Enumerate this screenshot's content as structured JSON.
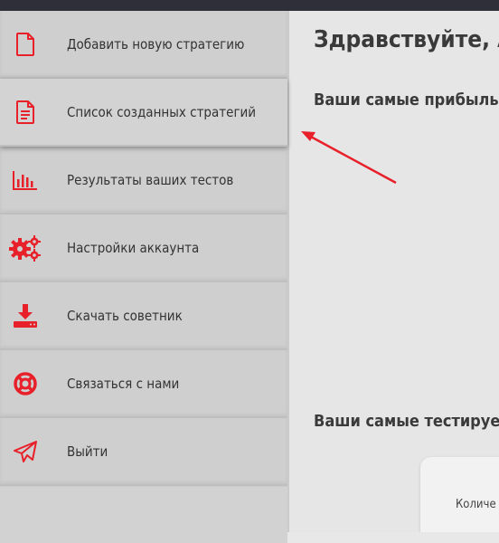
{
  "colors": {
    "accent": "#e8202a",
    "topbar": "#2e2f38",
    "sidebar_bg": "#cbcbcb",
    "main_bg": "#e6e6e6"
  },
  "sidebar": {
    "items": [
      {
        "label": "Добавить новую стратегию",
        "icon": "file-icon"
      },
      {
        "label": "Список созданных стратегий",
        "icon": "document-list-icon"
      },
      {
        "label": "Результаты ваших тестов",
        "icon": "bar-chart-icon"
      },
      {
        "label": "Настройки аккаунта",
        "icon": "gears-icon"
      },
      {
        "label": "Скачать советник",
        "icon": "download-icon"
      },
      {
        "label": "Связаться с нами",
        "icon": "lifebuoy-icon"
      },
      {
        "label": "Выйти",
        "icon": "paper-plane-icon"
      }
    ]
  },
  "main": {
    "greeting": "Здравствуйте, А",
    "section_profitable": "Ваши самые прибыль",
    "section_tested": "Ваши самые тестируе",
    "card_label": "Количе"
  }
}
